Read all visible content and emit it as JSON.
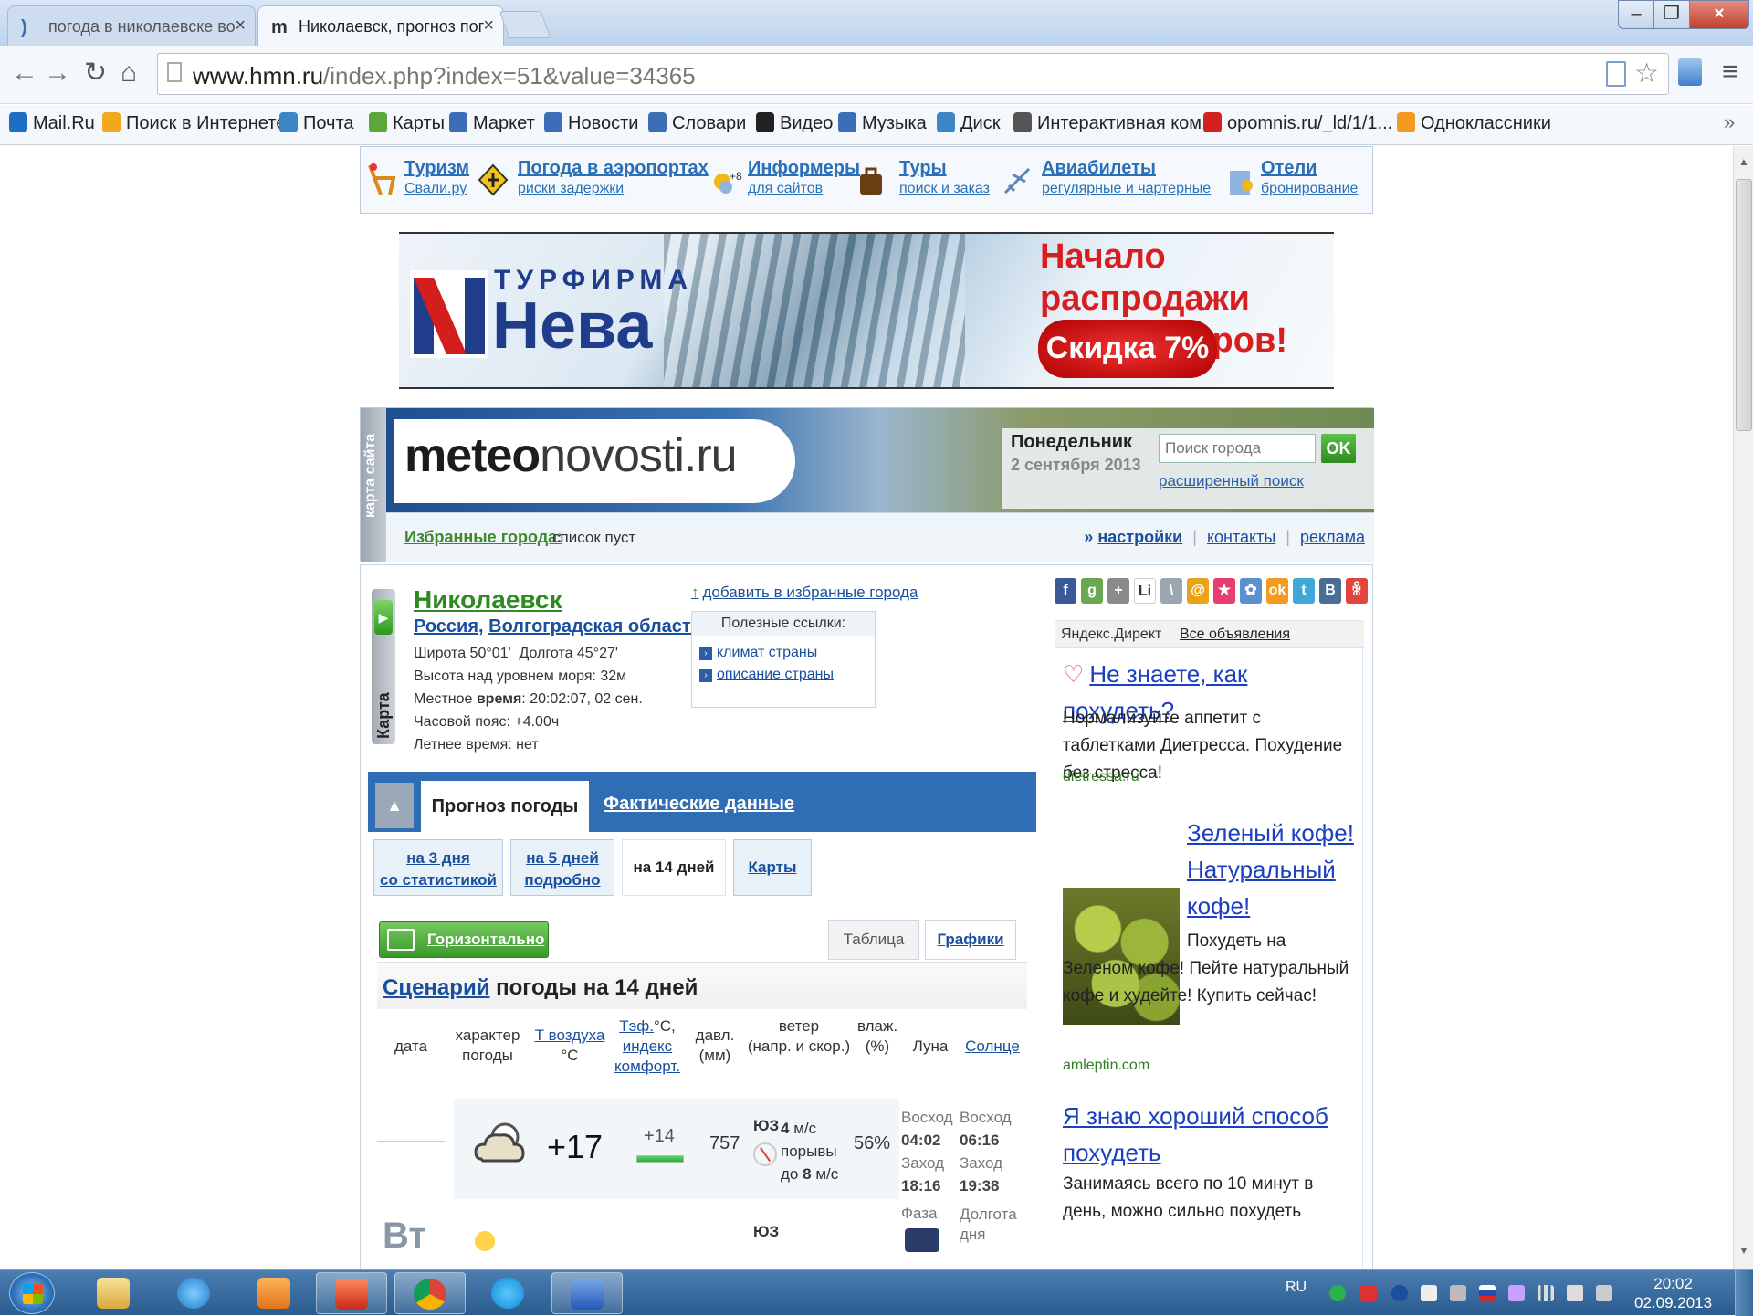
{
  "browser": {
    "tabs": [
      {
        "label": "погода в николаевске во",
        "active": false
      },
      {
        "label": "Николаевск, прогноз пог",
        "active": true
      }
    ],
    "tab_icon_active": "m",
    "url_host": "www.hmn.ru",
    "url_path": "/index.php?index=51&value=34365",
    "bookmarks": [
      {
        "label": "Mail.Ru",
        "color": "#1d6fc4"
      },
      {
        "label": "Поиск в Интернете",
        "color": "#f3a71f"
      },
      {
        "label": "Почта",
        "color": "#3c86c8"
      },
      {
        "label": "Карты",
        "color": "#5aa83a"
      },
      {
        "label": "Маркет",
        "color": "#3c6eb8"
      },
      {
        "label": "Новости",
        "color": "#3c6eb8"
      },
      {
        "label": "Словари",
        "color": "#3c6eb8"
      },
      {
        "label": "Видео",
        "color": "#222222"
      },
      {
        "label": "Музыка",
        "color": "#3c6eb8"
      },
      {
        "label": "Диск",
        "color": "#3c86c8"
      },
      {
        "label": "Интерактивная ком...",
        "color": "#555555"
      },
      {
        "label": "opomnis.ru/_ld/1/1...",
        "color": "#d42020"
      },
      {
        "label": "Одноклассники",
        "color": "#f39a1f"
      }
    ],
    "bookmarks_more": "»"
  },
  "services": [
    {
      "title": "Туризм",
      "sub": "Свали.ру"
    },
    {
      "title": "Погода в аэропортах",
      "sub": "риски задержки"
    },
    {
      "title": "Информеры",
      "sub": "для сайтов"
    },
    {
      "title": "Туры",
      "sub": "поиск и заказ"
    },
    {
      "title": "Авиабилеты",
      "sub": "регулярные и чартерные"
    },
    {
      "title": "Отели",
      "sub": "бронирование"
    }
  ],
  "banner": {
    "brand_top": "ТУРФИРМА",
    "brand_main": "Нева",
    "promo_line1": "Начало распродажи",
    "promo_line2": "зимних туров!",
    "discount": "Скидка 7%"
  },
  "header": {
    "sitemap": "карта сайта",
    "logo_bold": "meteo",
    "logo_rest": "novosti.ru",
    "day": "Понедельник",
    "date": "2 сентября 2013",
    "search_placeholder": "Поиск города",
    "search_button": "OK",
    "advanced_search": "расширенный поиск",
    "favorites_label": "Избранные города:",
    "favorites_value": "список пуст",
    "link_settings": "настройки",
    "link_contacts": "контакты",
    "link_ads": "реклама"
  },
  "city": {
    "map_label": "Карта",
    "name": "Николаевск",
    "country": "Россия",
    "region": "Волгоградская область",
    "lat": "Широта 50°01'",
    "lon": "Долгота 45°27'",
    "altitude": "Высота над уровнем моря: 32м",
    "local_time_prefix": "Местное",
    "local_time_word": "время",
    "local_time_value": ": 20:02:07, 02 сен.",
    "timezone": "Часовой пояс: +4.00ч",
    "dst": "Летнее время: нет",
    "add_fav": "добавить в избранные города",
    "useful_title": "Полезные ссылки:",
    "useful_links": [
      "климат страны",
      "описание страны"
    ]
  },
  "forecast": {
    "tab_active": "Прогноз погоды",
    "tab_other": "Фактические данные",
    "subtabs": [
      {
        "l1": "на 3 дня",
        "l2": "со статистикой"
      },
      {
        "l1": "на 5 дней",
        "l2": "подробно"
      },
      {
        "l1": "на 14 дней",
        "l2": ""
      },
      {
        "l1": "Карты",
        "l2": ""
      }
    ],
    "horizontal": "Горизонтально",
    "view_table": "Таблица",
    "view_graphs": "Графики",
    "scenario_link": "Сценарий",
    "scenario_rest": " погоды на 14 дней",
    "columns": {
      "date": "дата",
      "char1": "характер",
      "char2": "погоды",
      "tair1": "Т воздуха",
      "tair2": "°С",
      "teff1": "Тэф.",
      "teff1b": "°С,",
      "teff2": "индекс",
      "teff3": "комфорт.",
      "press1": "давл.",
      "press2": "(мм)",
      "wind1": "ветер",
      "wind2": "(напр. и скор.)",
      "hum1": "влаж.",
      "hum2": "(%)",
      "moon": "Луна",
      "sun": "Солнце"
    },
    "row1": {
      "temp": "+17",
      "feels": "+14",
      "pressure": "757",
      "wind_dir": "ЮЗ",
      "wind_speed": "4",
      "wind_unit": "м/с",
      "gusts_label": "порывы",
      "gusts_prefix": "до",
      "gusts": "8",
      "humidity": "56%",
      "moon_rise_label": "Восход",
      "moon_rise": "04:02",
      "moon_set_label": "Заход",
      "moon_set": "18:16",
      "sun_rise_label": "Восход",
      "sun_rise": "06:16",
      "sun_set_label": "Заход",
      "sun_set": "19:38"
    },
    "row2": {
      "day": "Вт",
      "wind_dir": "ЮЗ",
      "moon_phase": "Фаза",
      "sun_lon1": "Долгота",
      "sun_lon2": "дня"
    }
  },
  "ads": {
    "header": "Яндекс.Директ",
    "all": "Все объявления",
    "ad1_title": "Не знаете, как похудеть?",
    "ad1_text": "Нормализуйте аппетит с таблетками Диетресса. Похудение без стресса!",
    "ad1_url": "dietressa.ru",
    "ad2_title": "Зеленый кофе! Натуральный кофе!",
    "ad2_text": "Похудеть на Зеленом кофе! Пейте натуральный кофе и худейте! Купить сейчас!",
    "ad2_url": "amleptin.com",
    "ad3_title": "Я знаю хороший способ похудеть",
    "ad3_text": "Занимаясь всего по 10 минут в день, можно сильно похудеть"
  },
  "social_icons": [
    {
      "name": "facebook-icon",
      "glyph": "f",
      "color": "#3b5998"
    },
    {
      "name": "google-icon",
      "glyph": "g",
      "color": "#6aa84f"
    },
    {
      "name": "plus-icon",
      "glyph": "+",
      "color": "#8a8a8a"
    },
    {
      "name": "liveinternet-icon",
      "glyph": "Li",
      "color": "#ffffff"
    },
    {
      "name": "pen-icon",
      "glyph": "\\",
      "color": "#9aa6b2"
    },
    {
      "name": "mailru-icon",
      "glyph": "@",
      "color": "#e8a317"
    },
    {
      "name": "star-icon",
      "glyph": "★",
      "color": "#e63e6d"
    },
    {
      "name": "myworld-icon",
      "glyph": "✿",
      "color": "#5b8fd1"
    },
    {
      "name": "odnoklassniki-icon",
      "glyph": "ok",
      "color": "#f39a1f"
    },
    {
      "name": "twitter-icon",
      "glyph": "t",
      "color": "#40a8d8"
    },
    {
      "name": "vk-icon",
      "glyph": "B",
      "color": "#4a6d94"
    },
    {
      "name": "figure-icon",
      "glyph": "ꆜ",
      "color": "#e0463d"
    }
  ],
  "taskbar": {
    "lang": "RU",
    "time": "20:02",
    "date": "02.09.2013"
  }
}
